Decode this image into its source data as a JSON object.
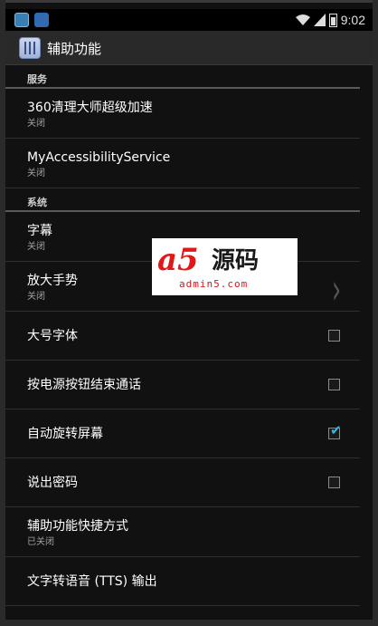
{
  "status_bar": {
    "time": "9:02",
    "icons": [
      "app-notification-icon",
      "app-notification-icon-2",
      "wifi-icon",
      "signal-icon",
      "battery-icon"
    ]
  },
  "action_bar": {
    "title": "辅助功能",
    "icon": "accessibility-app-icon"
  },
  "sections": {
    "services": {
      "header": "服务",
      "items": [
        {
          "label": "360清理大师超级加速",
          "summary": "关闭"
        },
        {
          "label": "MyAccessibilityService",
          "summary": "关闭"
        }
      ]
    },
    "system": {
      "header": "系统",
      "items": [
        {
          "label": "字幕",
          "summary": "关闭"
        },
        {
          "label": "放大手势",
          "summary": "关闭"
        },
        {
          "label": "大号字体",
          "checked": false
        },
        {
          "label": "按电源按钮结束通话",
          "checked": false
        },
        {
          "label": "自动旋转屏幕",
          "checked": true
        },
        {
          "label": "说出密码",
          "checked": false
        },
        {
          "label": "辅助功能快捷方式",
          "summary": "已关闭"
        },
        {
          "label": "文字转语音 (TTS) 输出"
        }
      ]
    }
  },
  "watermark": {
    "logo": "a5",
    "name": "源码",
    "url": "admin5.com"
  },
  "colors": {
    "accent": "#33b5e5",
    "background": "#111111",
    "watermark_red": "#e01818"
  }
}
